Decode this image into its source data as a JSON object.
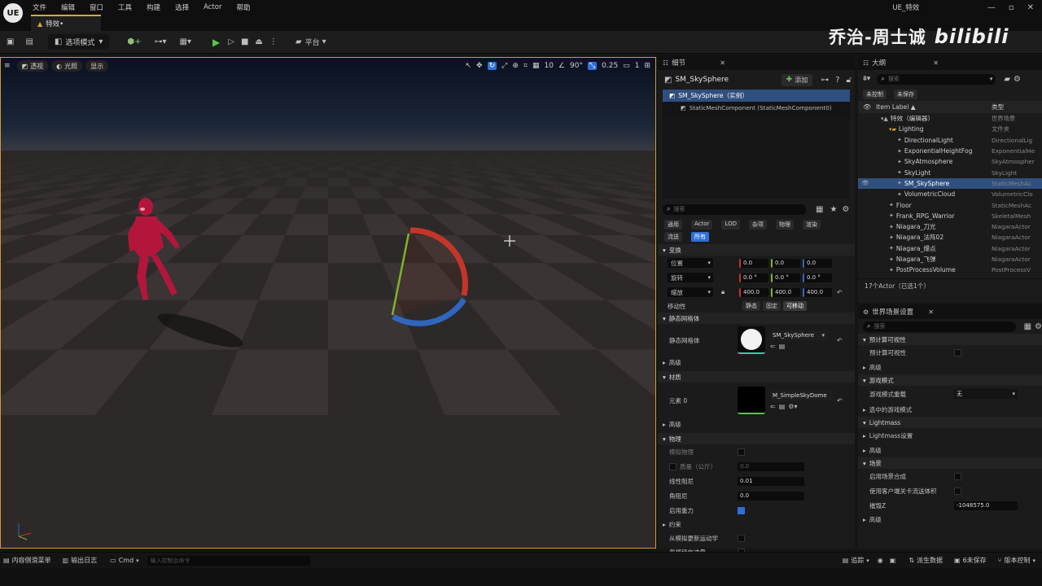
{
  "app": {
    "logo": "UE",
    "window_title": "UE_特效",
    "doc_tab": "特效•"
  },
  "menu": [
    "文件",
    "编辑",
    "窗口",
    "工具",
    "构建",
    "选择",
    "Actor",
    "帮助"
  ],
  "window_controls": [
    "—",
    "▫",
    "✕"
  ],
  "toolbar": {
    "mode": "选项模式",
    "platform": "平台"
  },
  "viewport": {
    "view_btn": "透视",
    "lit_btn": "光照",
    "show_btn": "显示",
    "grid": "10",
    "angle": "90°",
    "scale": "0.25",
    "cam": "1"
  },
  "details": {
    "tab": "细节",
    "actor_name": "SM_SkySphere",
    "add_btn": "添加",
    "tree": [
      "SM_SkySphere（实例）",
      "StaticMeshComponent (StaticMeshComponent0)"
    ],
    "search_placeholder": "搜索",
    "filters": [
      "通用",
      "Actor",
      "LOD",
      "杂项",
      "物理",
      "渲染",
      "流送",
      "所有"
    ],
    "transform": {
      "header": "变换",
      "location_label": "位置",
      "location": [
        "0.0",
        "0.0",
        "0.0"
      ],
      "rotation_label": "旋转",
      "rotation": [
        "0.0 °",
        "0.0 °",
        "0.0 °"
      ],
      "scale_label": "缩放",
      "scale": [
        "400.0",
        "400.0",
        "400.0"
      ],
      "mobility_label": "移动性",
      "mobility": [
        "静态",
        "固定",
        "可移动"
      ]
    },
    "static_mesh": {
      "header": "静态网格体",
      "label": "静态网格体",
      "value": "SM_SkySphere"
    },
    "advanced": "高级",
    "materials": {
      "header": "材质",
      "element_label": "元素 0",
      "value": "M_SimpleSkyDome"
    },
    "physics": {
      "header": "物理",
      "simulate": "模拟物理",
      "mass": "质量（公斤）",
      "mass_value": "0.0",
      "linear_damping": "线性阻尼",
      "linear_damping_value": "0.01",
      "angular_damping": "角阻尼",
      "angular_damping_value": "0.0",
      "gravity": "启用重力"
    },
    "constraints": {
      "header": "约束",
      "kinematic": "从模拟更新运动学",
      "ignore_radial": "忽视径向冲量"
    }
  },
  "outliner": {
    "tab": "大纲",
    "search_placeholder": "搜索",
    "chips": [
      "未控制",
      "未保存"
    ],
    "col_label": "Item Label ▲",
    "col_type": "类型",
    "items": [
      {
        "label": "特效（编辑器）",
        "type": "世界场景",
        "indent": 1
      },
      {
        "label": "Lighting",
        "type": "文件夹",
        "indent": 2
      },
      {
        "label": "DirectionalLight",
        "type": "DirectionalLig",
        "indent": 3
      },
      {
        "label": "ExponentialHeightFog",
        "type": "ExponentialHe",
        "indent": 3
      },
      {
        "label": "SkyAtmosphere",
        "type": "SkyAtmospher",
        "indent": 3
      },
      {
        "label": "SkyLight",
        "type": "SkyLight",
        "indent": 3
      },
      {
        "label": "SM_SkySphere",
        "type": "StaticMeshAc",
        "indent": 3,
        "selected": true
      },
      {
        "label": "VolumetricCloud",
        "type": "VolumetricClo",
        "indent": 3
      },
      {
        "label": "Floor",
        "type": "StaticMeshAc",
        "indent": 2
      },
      {
        "label": "Frank_RPG_Warrior",
        "type": "SkeletalMesh",
        "indent": 2
      },
      {
        "label": "Niagara_刀光",
        "type": "NiagaraActor",
        "indent": 2
      },
      {
        "label": "Niagara_法阵02",
        "type": "NiagaraActor",
        "indent": 2
      },
      {
        "label": "Niagara_爆点",
        "type": "NiagaraActor",
        "indent": 2
      },
      {
        "label": "Niagara_飞弹",
        "type": "NiagaraActor",
        "indent": 2
      },
      {
        "label": "PostProcessVolume",
        "type": "PostProcessV",
        "indent": 2
      }
    ],
    "footer": "17个Actor（已选1个）"
  },
  "world_settings": {
    "tab": "世界场景设置",
    "search_placeholder": "搜索",
    "precomputed_header": "预计算可视性",
    "precomputed_label": "预计算可视性",
    "advanced": "高级",
    "game_mode_header": "游戏模式",
    "game_mode_override": "游戏模式重载",
    "game_mode_value": "无",
    "selected_game_mode": "选中的游戏模式",
    "lightmass_header": "Lightmass",
    "lightmass_settings": "Lightmass设置",
    "world_header": "场景",
    "enable_composition": "启用场景合成",
    "client_nav": "使用客户端关卡流送体积",
    "killz_label": "摧毁Z",
    "killz_value": "-1048575.0"
  },
  "statusbar": {
    "content_drawer": "内容侧滑菜单",
    "output_log": "输出日志",
    "cmd": "Cmd",
    "cmd_placeholder": "输入控制台命令",
    "trace": "追踪",
    "derived_data": "派生数据",
    "unsaved": "6未保存",
    "source_control": "版本控制"
  },
  "watermark": {
    "name": "乔治-周士诚",
    "brand": "bilibili"
  }
}
